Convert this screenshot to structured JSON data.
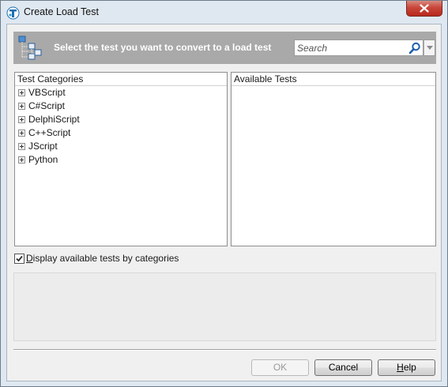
{
  "window": {
    "title": "Create Load Test",
    "app_icon": "testcomplete-logo-icon",
    "close_icon": "close-icon"
  },
  "banner": {
    "icon": "tree-structure-icon",
    "text": "Select the test you want to convert to a load test",
    "search": {
      "placeholder": "Search",
      "value": "",
      "icon": "search-icon",
      "dropdown_icon": "chevron-down-icon"
    }
  },
  "categories": {
    "header": "Test Categories",
    "items": [
      {
        "label": "VBScript",
        "expanded": false
      },
      {
        "label": "C#Script",
        "expanded": false
      },
      {
        "label": "DelphiScript",
        "expanded": false
      },
      {
        "label": "C++Script",
        "expanded": false
      },
      {
        "label": "JScript",
        "expanded": false
      },
      {
        "label": "Python",
        "expanded": false
      }
    ]
  },
  "available": {
    "header": "Available Tests",
    "items": []
  },
  "options": {
    "display_by_categories_label": "Display available tests by categories",
    "display_by_categories_checked": true
  },
  "description": "",
  "buttons": {
    "ok": "OK",
    "ok_enabled": false,
    "cancel": "Cancel",
    "help": "Help"
  },
  "colors": {
    "banner_bg": "#a9a9a9",
    "window_frame": "#dfe8f1",
    "close_button": "#c9463a",
    "search_icon": "#1f5fae"
  }
}
